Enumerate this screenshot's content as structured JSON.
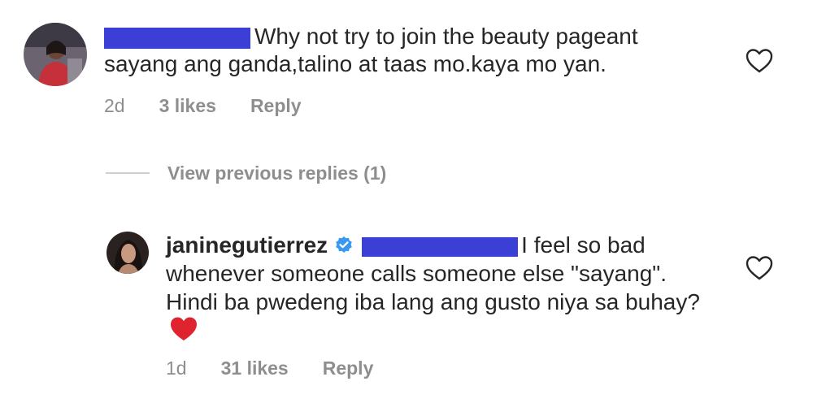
{
  "comment": {
    "text": "Why not try to join the beauty pageant sayang ang ganda,talino at taas mo.kaya mo yan.",
    "time": "2d",
    "likes": "3 likes",
    "reply_label": "Reply"
  },
  "view_replies": "View previous replies (1)",
  "reply": {
    "username": "janinegutierrez",
    "text": "I feel so bad whenever someone calls someone else \"sayang\". Hindi ba pwedeng iba lang ang gusto niya sa buhay?",
    "emoji": "❤️",
    "time": "1d",
    "likes": "31 likes",
    "reply_label": "Reply"
  },
  "colors": {
    "redaction": "#3b3fd6",
    "meta": "#8e8e8e",
    "verified": "#3897f0",
    "heart_emoji": "#e0242f"
  }
}
